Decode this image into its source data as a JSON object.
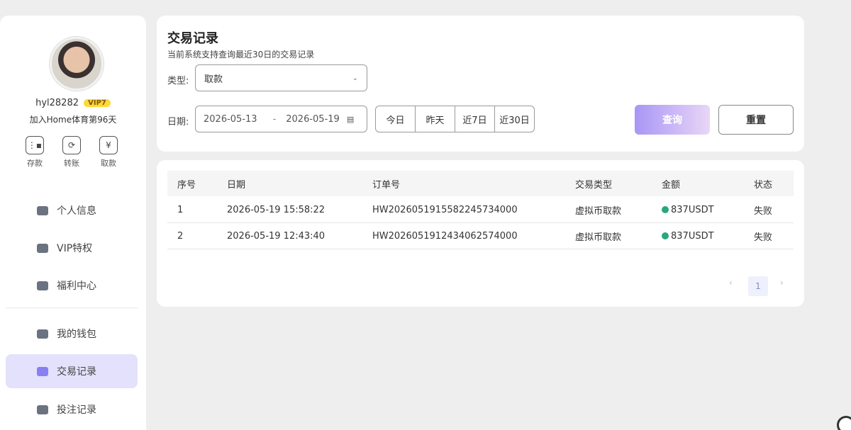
{
  "sidebar": {
    "username": "hyl28282",
    "vip_level": "VIP7",
    "join_text": "加入Home体育第96天",
    "quick_actions": [
      {
        "label": "存款",
        "icon": "deposit-icon"
      },
      {
        "label": "转账",
        "icon": "transfer-icon"
      },
      {
        "label": "取款",
        "icon": "withdraw-icon"
      }
    ],
    "nav": [
      {
        "label": "个人信息",
        "icon": "profile-icon"
      },
      {
        "label": "VIP特权",
        "icon": "crown-icon"
      },
      {
        "label": "福利中心",
        "icon": "gift-icon"
      },
      {
        "label": "我的钱包",
        "icon": "wallet-icon"
      },
      {
        "label": "交易记录",
        "icon": "transaction-icon",
        "active": true
      },
      {
        "label": "投注记录",
        "icon": "bet-record-icon"
      }
    ]
  },
  "filter": {
    "title": "交易记录",
    "subtitle": "当前系统支持查询最近30日的交易记录",
    "type_label": "类型:",
    "type_value": "取款",
    "date_label": "日期:",
    "date_start": "2026-05-13",
    "date_sep": "-",
    "date_end": "2026-05-19",
    "quick_ranges": [
      "今日",
      "昨天",
      "近7日",
      "近30日"
    ],
    "query_label": "查询",
    "reset_label": "重置"
  },
  "table": {
    "headers": [
      "序号",
      "日期",
      "订单号",
      "交易类型",
      "金额",
      "状态"
    ],
    "rows": [
      {
        "no": "1",
        "date": "2026-05-19 15:58:22",
        "order": "HW2026051915582245734000",
        "type": "虚拟币取款",
        "amount": "837USDT",
        "status": "失败"
      },
      {
        "no": "2",
        "date": "2026-05-19 12:43:40",
        "order": "HW2026051912434062574000",
        "type": "虚拟币取款",
        "amount": "837USDT",
        "status": "失败"
      }
    ]
  },
  "pagination": {
    "prev": "‹",
    "current": "1",
    "next": "›"
  },
  "colors": {
    "accent": "#a996f5",
    "active_nav": "#e3e1fb",
    "coin": "#2aa57f"
  }
}
